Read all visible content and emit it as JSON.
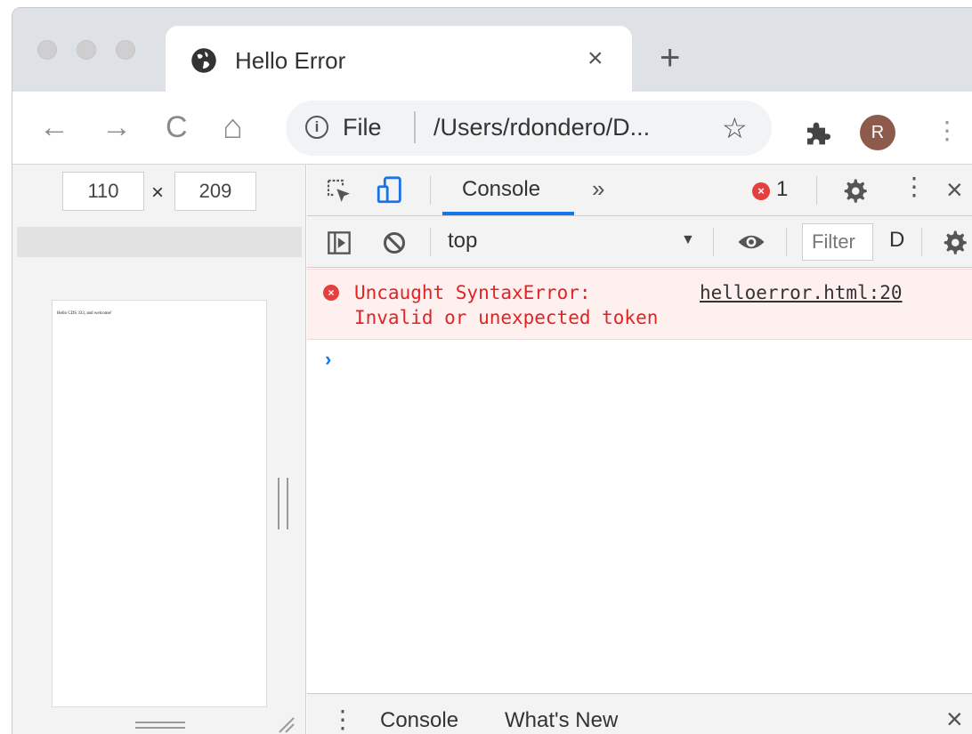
{
  "browser": {
    "tab": {
      "title": "Hello Error",
      "close": "×"
    },
    "new_tab": "+",
    "toolbar": {
      "back": "←",
      "forward": "→",
      "reload": "C",
      "home": "⌂",
      "omnibox": {
        "scheme": "File",
        "url": "/Users/rdondero/D..."
      },
      "bookmark": "☆",
      "avatar_initial": "R",
      "menu": "⋮"
    }
  },
  "device_toolbar": {
    "width": "110",
    "separator": "×",
    "height": "209"
  },
  "page_preview": {
    "text": "Hello CDS 333, and welcome!"
  },
  "devtools": {
    "tabs": {
      "active": "Console",
      "more": "»"
    },
    "error_count": "1",
    "close": "×",
    "console_toolbar": {
      "context": "top",
      "filter_placeholder": "Filter",
      "levels": "D"
    },
    "messages": [
      {
        "level": "error",
        "text": "Uncaught SyntaxError:\nInvalid or unexpected token",
        "source": "helloerror.html:20"
      }
    ],
    "prompt": "›",
    "drawer": {
      "tabs": [
        "Console",
        "What's New"
      ],
      "close": "×"
    }
  },
  "colors": {
    "error_red": "#e02424",
    "error_bg": "#fff0f0",
    "accent_blue": "#1a73e8",
    "avatar_bg": "#8d5b4c"
  }
}
